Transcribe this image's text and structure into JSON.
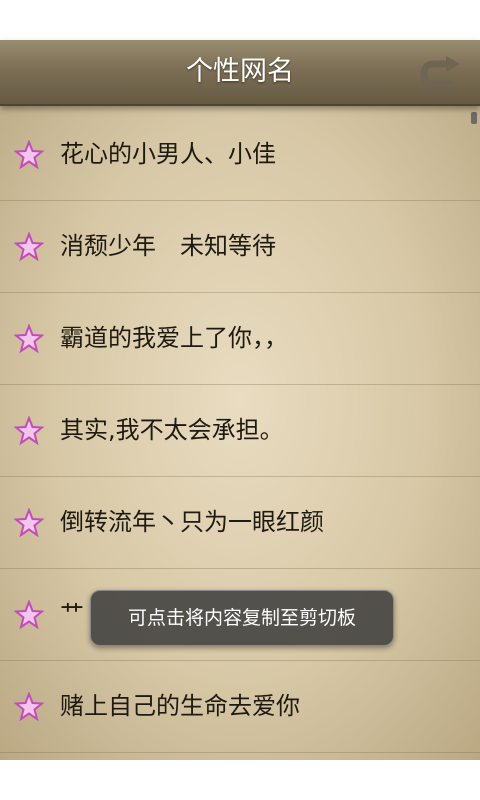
{
  "header": {
    "title": "个性网名",
    "back_icon": "undo-arrow-icon"
  },
  "list": {
    "icon": "pink-star-icon",
    "items": [
      {
        "label": "花心的小男人、小佳"
      },
      {
        "label": "消颓少年　未知等待"
      },
      {
        "label": "霸道的我爱上了你，，"
      },
      {
        "label": "其实,我不太会承担。"
      },
      {
        "label": "倒转流年丶只为一眼红颜"
      },
      {
        "label": "艹"
      },
      {
        "label": "赌上自己的生命去爱你"
      }
    ]
  },
  "toast": {
    "message": "可点击将内容复制至剪切板"
  },
  "colors": {
    "header": "#7c6f55",
    "paper": "#e2d4b5",
    "star": "#e07ad6",
    "toast": "#3c3c3c"
  }
}
